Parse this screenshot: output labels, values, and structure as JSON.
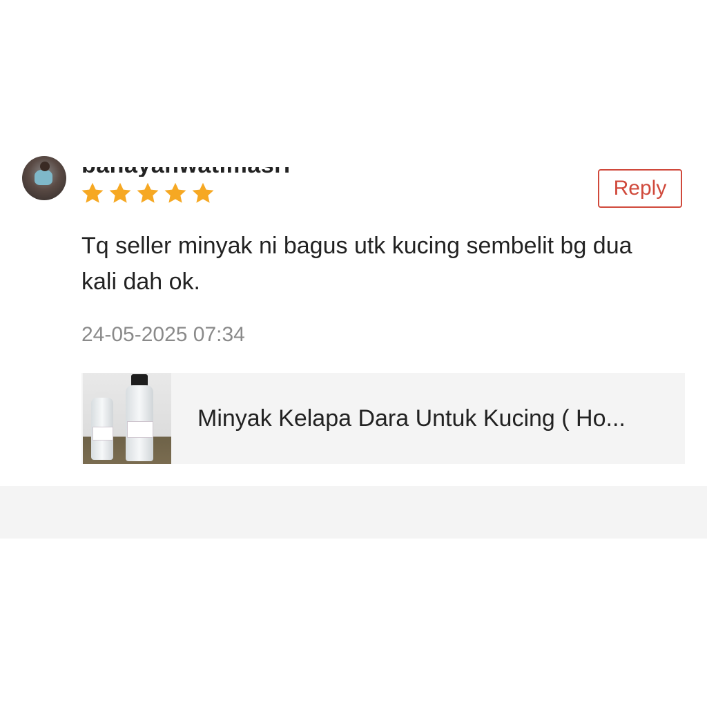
{
  "review": {
    "username": "banayanwatimasri",
    "rating": 5,
    "rating_max": 5,
    "text": "Tq seller minyak ni bagus utk kucing sembelit bg dua kali dah ok.",
    "timestamp": "24-05-2025 07:34",
    "reply_label": "Reply"
  },
  "product": {
    "name": "Minyak Kelapa Dara Untuk Kucing ( Ho..."
  },
  "colors": {
    "star": "#f6a823",
    "accent": "#d0493b",
    "card_bg": "#f4f4f4",
    "muted_text": "#8a8a8a"
  }
}
